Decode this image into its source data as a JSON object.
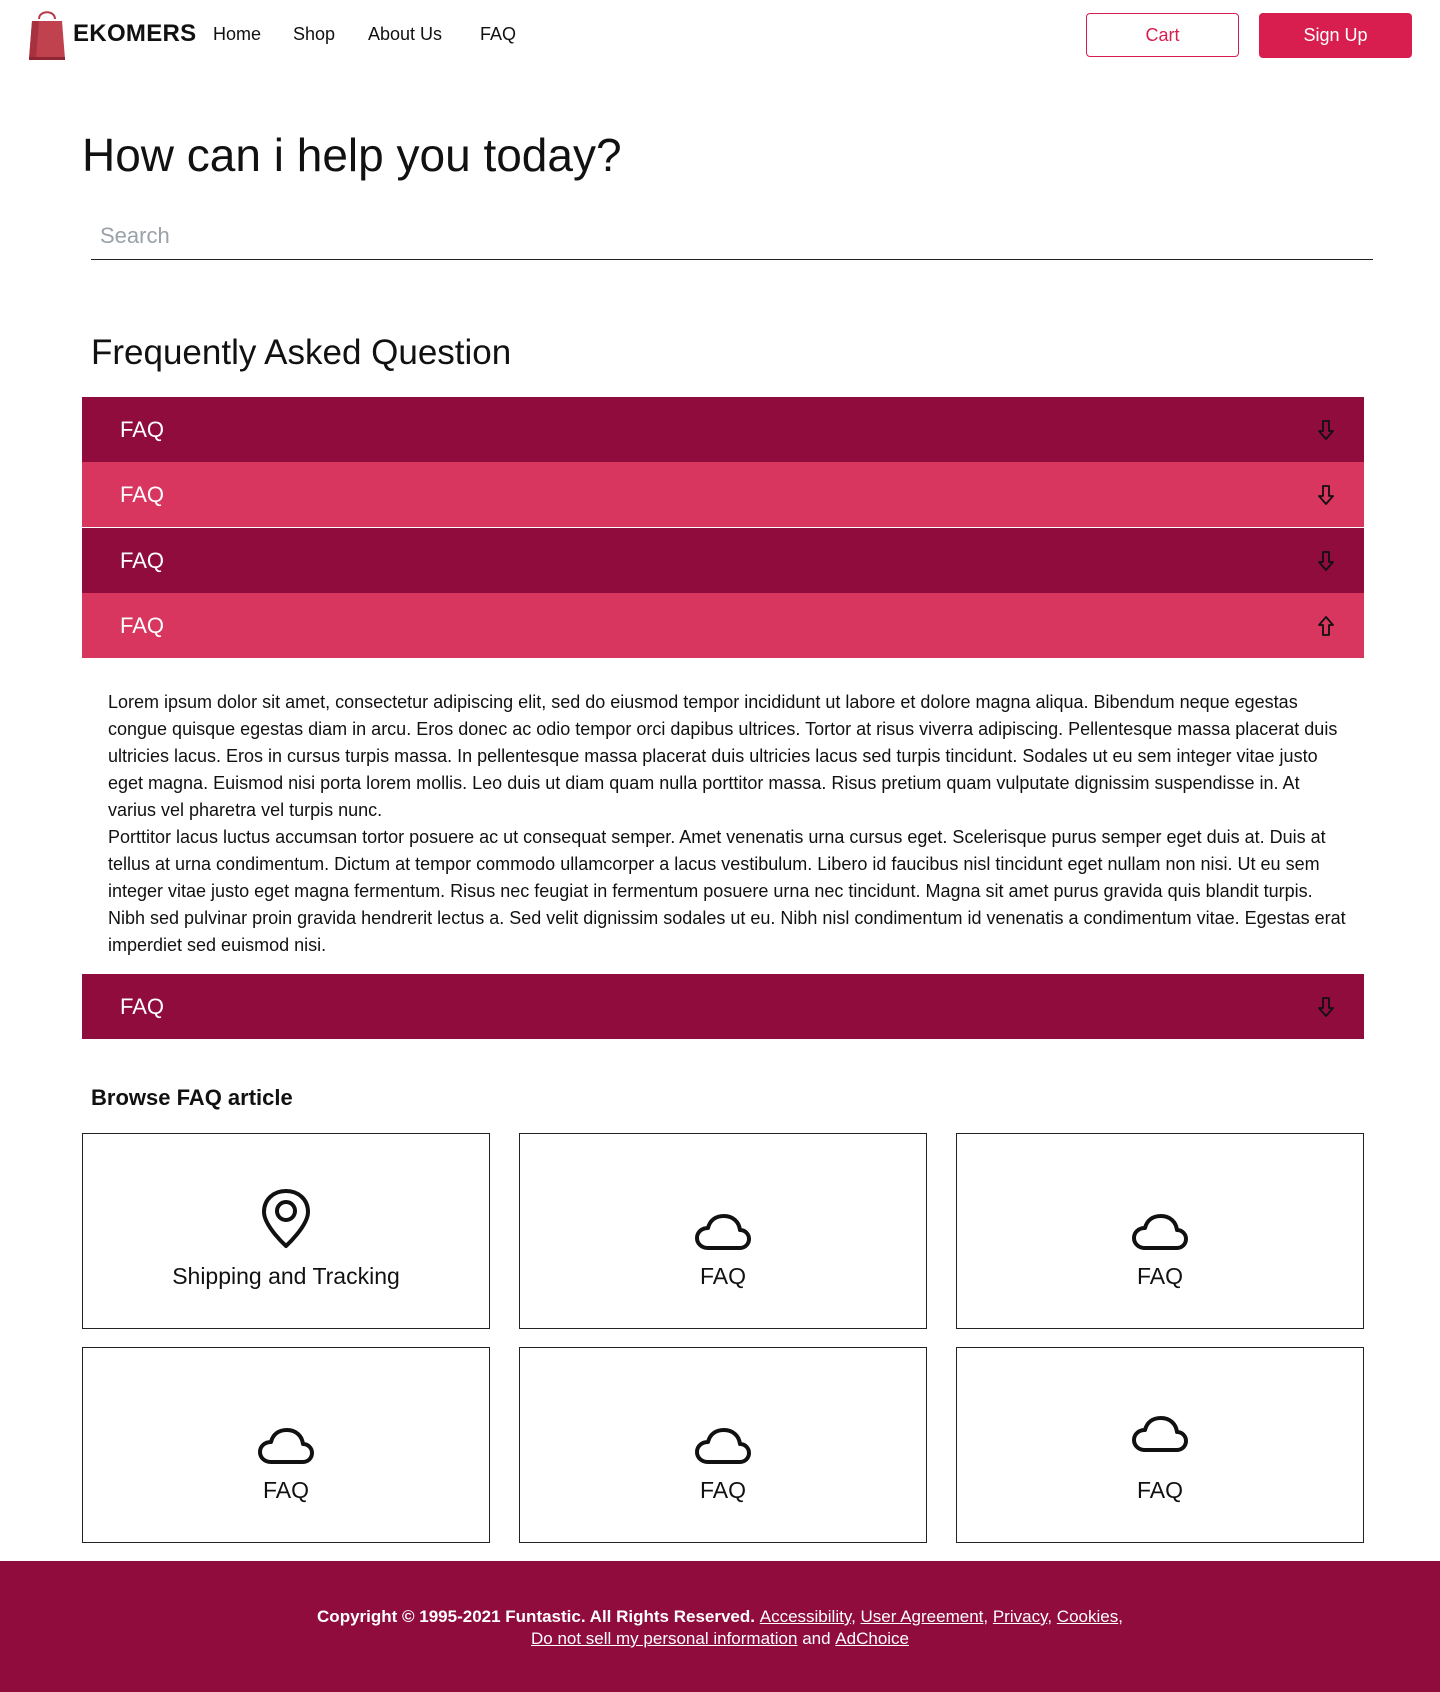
{
  "nav": {
    "brand": "EKOMERS",
    "links": [
      "Home",
      "Shop",
      "About Us",
      "FAQ"
    ],
    "cart_label": "Cart",
    "signup_label": "Sign Up"
  },
  "hero": {
    "title": "How can i help you today?",
    "search_placeholder": "Search"
  },
  "faq_section": {
    "heading": "Frequently Asked Question",
    "items": [
      {
        "label": "FAQ",
        "state": "collapsed"
      },
      {
        "label": "FAQ",
        "state": "collapsed"
      },
      {
        "label": "FAQ",
        "state": "collapsed"
      },
      {
        "label": "FAQ",
        "state": "expanded"
      },
      {
        "label": "FAQ",
        "state": "collapsed"
      }
    ],
    "expanded_paragraphs": [
      "Lorem ipsum dolor sit amet, consectetur adipiscing elit, sed do eiusmod tempor incididunt ut labore et dolore magna aliqua. Bibendum neque egestas congue quisque egestas diam in arcu. Eros donec ac odio tempor orci dapibus ultrices. Tortor at risus viverra adipiscing. Pellentesque massa placerat duis ultricies lacus. Eros in cursus turpis massa. In pellentesque massa placerat duis ultricies lacus sed turpis tincidunt. Sodales ut eu sem integer vitae justo eget magna. Euismod nisi porta lorem mollis. Leo duis ut diam quam nulla porttitor massa. Risus pretium quam vulputate dignissim suspendisse in. At varius vel pharetra vel turpis nunc.",
      "Porttitor lacus luctus accumsan tortor posuere ac ut consequat semper. Amet venenatis urna cursus eget. Scelerisque purus semper eget duis at. Duis at tellus at urna condimentum. Dictum at tempor commodo ullamcorper a lacus vestibulum. Libero id faucibus nisl tincidunt eget nullam non nisi. Ut eu sem integer vitae justo eget magna fermentum. Risus nec feugiat in fermentum posuere urna nec tincidunt. Magna sit amet purus gravida quis blandit turpis. Nibh sed pulvinar proin gravida hendrerit lectus a. Sed velit dignissim sodales ut eu. Nibh nisl condimentum id venenatis a condimentum vitae. Egestas erat imperdiet sed euismod nisi."
    ]
  },
  "browse": {
    "heading": "Browse FAQ article",
    "cards": [
      {
        "label": "Shipping and Tracking",
        "icon": "map-pin-icon"
      },
      {
        "label": "FAQ",
        "icon": "cloud-icon"
      },
      {
        "label": "FAQ",
        "icon": "cloud-icon"
      },
      {
        "label": "FAQ",
        "icon": "cloud-icon"
      },
      {
        "label": "FAQ",
        "icon": "cloud-icon"
      },
      {
        "label": "FAQ",
        "icon": "cloud-icon"
      }
    ]
  },
  "footer": {
    "copyright": "Copyright © 1995-2021 Funtastic. All Rights Reserved.",
    "links": [
      "Accessibility",
      "User Agreement",
      "Privacy",
      "Cookies",
      "Do not sell my personal information",
      "AdChoice"
    ],
    "and_text": "and"
  },
  "colors": {
    "brand_red": "#d81e4f",
    "accordion_dark": "#8f0c3c",
    "accordion_light": "#d8355f",
    "footer_bg": "#8f0c3c"
  }
}
